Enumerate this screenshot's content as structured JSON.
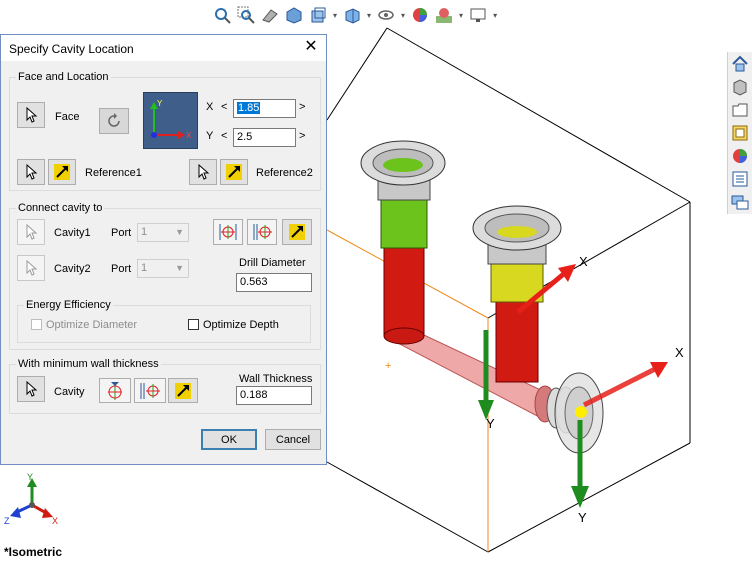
{
  "dialog": {
    "title": "Specify Cavity Location",
    "face_and_location": {
      "title": "Face and Location",
      "face_label": "Face",
      "x_label": "X",
      "x_value": "1.85",
      "y_label": "Y",
      "y_value": "2.5",
      "reference1_label": "Reference1",
      "reference2_label": "Reference2"
    },
    "connect_cavity": {
      "title": "Connect cavity to",
      "cavity1_label": "Cavity1",
      "cavity2_label": "Cavity2",
      "port_label": "Port",
      "port1_value": "1",
      "port2_value": "1",
      "drill_diameter_label": "Drill Diameter",
      "drill_diameter_value": "0.563",
      "energy_efficiency_title": "Energy Efficiency",
      "optimize_diameter_label": "Optimize Diameter",
      "optimize_depth_label": "Optimize Depth"
    },
    "wall_thickness": {
      "title": "With minimum wall thickness",
      "cavity_label": "Cavity",
      "wall_thickness_label": "Wall Thickness",
      "wall_thickness_value": "0.188"
    },
    "ok_label": "OK",
    "cancel_label": "Cancel"
  },
  "viewport": {
    "view_name": "*Isometric",
    "axis_labels": {
      "x": "X",
      "y": "Y",
      "z": "Z"
    }
  },
  "colors": {
    "accent": "#0078d7",
    "cavity_red": "#d11a12",
    "cavity_green": "#6cc31c",
    "cavity_yellow": "#d8d820",
    "axis_red": "#e8201a",
    "axis_green": "#1f8c1f",
    "block_orange": "#f08a1c"
  }
}
